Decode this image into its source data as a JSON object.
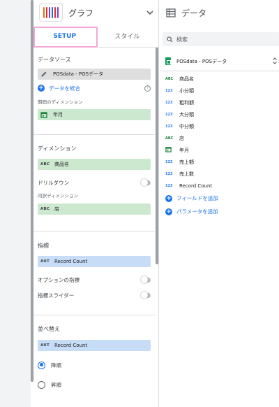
{
  "props": {
    "title": "グラフ",
    "chart_icon_colors": [
      "#e8710a",
      "#d93025",
      "#9334e6",
      "#1a73e8"
    ],
    "tabs": [
      {
        "label": "SETUP"
      },
      {
        "label": "スタイル"
      }
    ],
    "datasource": {
      "title": "データソース",
      "name": "POSdata - POSデータ",
      "blend_label": "データを統合",
      "period_dim_title": "期間のディメンション",
      "period_dim_value": "年月"
    },
    "dimension": {
      "title": "ディメンション",
      "tag": "ABC",
      "value": "商品名",
      "drilldown_label": "ドリルダウン",
      "breakdown_title": "内訳ディメンション",
      "breakdown_tag": "ABC",
      "breakdown_value": "店"
    },
    "metric": {
      "title": "指標",
      "tag": "AUT",
      "value": "Record Count",
      "optional_label": "オプションの指標",
      "slider_label": "指標スライダー"
    },
    "sort": {
      "title": "並べ替え",
      "tag": "AUT",
      "value": "Record Count",
      "desc_label": "降順",
      "asc_label": "昇順",
      "selected": "降順"
    }
  },
  "data_panel": {
    "title": "データ",
    "search_placeholder": "検索",
    "source_name": "POSdata - POSデータ",
    "fields": [
      {
        "type": "ABC",
        "kind": "dim",
        "name": "商品名"
      },
      {
        "type": "123",
        "kind": "met",
        "name": "小分類"
      },
      {
        "type": "123",
        "kind": "met",
        "name": "粗利額"
      },
      {
        "type": "123",
        "kind": "met",
        "name": "大分類"
      },
      {
        "type": "123",
        "kind": "met",
        "name": "中分類"
      },
      {
        "type": "ABC",
        "kind": "dim",
        "name": "店"
      },
      {
        "type": "calendar",
        "kind": "dim",
        "name": "年月"
      },
      {
        "type": "123",
        "kind": "met",
        "name": "売上額"
      },
      {
        "type": "123",
        "kind": "met",
        "name": "売上数"
      },
      {
        "type": "123",
        "kind": "met",
        "name": "Record Count"
      }
    ],
    "add_field_label": "フィールドを追加",
    "add_param_label": "パラメータを追加"
  }
}
